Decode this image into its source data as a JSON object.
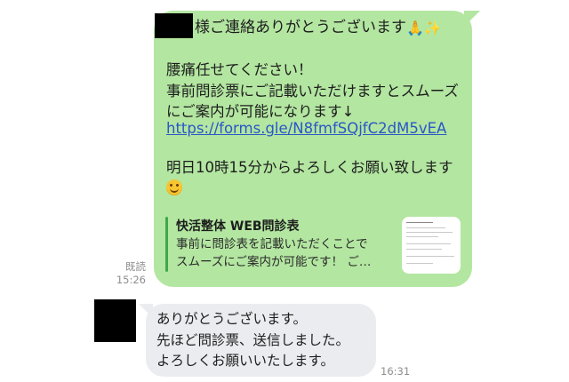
{
  "outgoing": {
    "first_line": "様ご連絡ありがとうございます",
    "first_line_emojis": "🙏✨",
    "body": "腰痛任せてください！\n事前問診票にご記載いただけますとスムーズにご案内が可能になります↓",
    "link": "https://forms.gle/N8fmfSQjfC2dM5vEA",
    "closing": "明日10時15分からよろしくお願い致します",
    "closing_emoji": "smiling-face-emoji",
    "preview": {
      "title": "快活整体 WEB問診表",
      "description": "事前に問診表を記載いただくことで\nスムーズにご案内が可能です！ ご…"
    },
    "read_label": "既読",
    "time": "15:26"
  },
  "incoming": {
    "text": "ありがとうございます。\n先ほど問診票、送信しました。\nよろしくお願いいたします。",
    "time": "16:31"
  },
  "colors": {
    "outgoing_bubble": "#b3e6a1",
    "incoming_bubble": "#ebecf0",
    "link": "#2a57c7",
    "preview_accent": "#3fa84a"
  }
}
